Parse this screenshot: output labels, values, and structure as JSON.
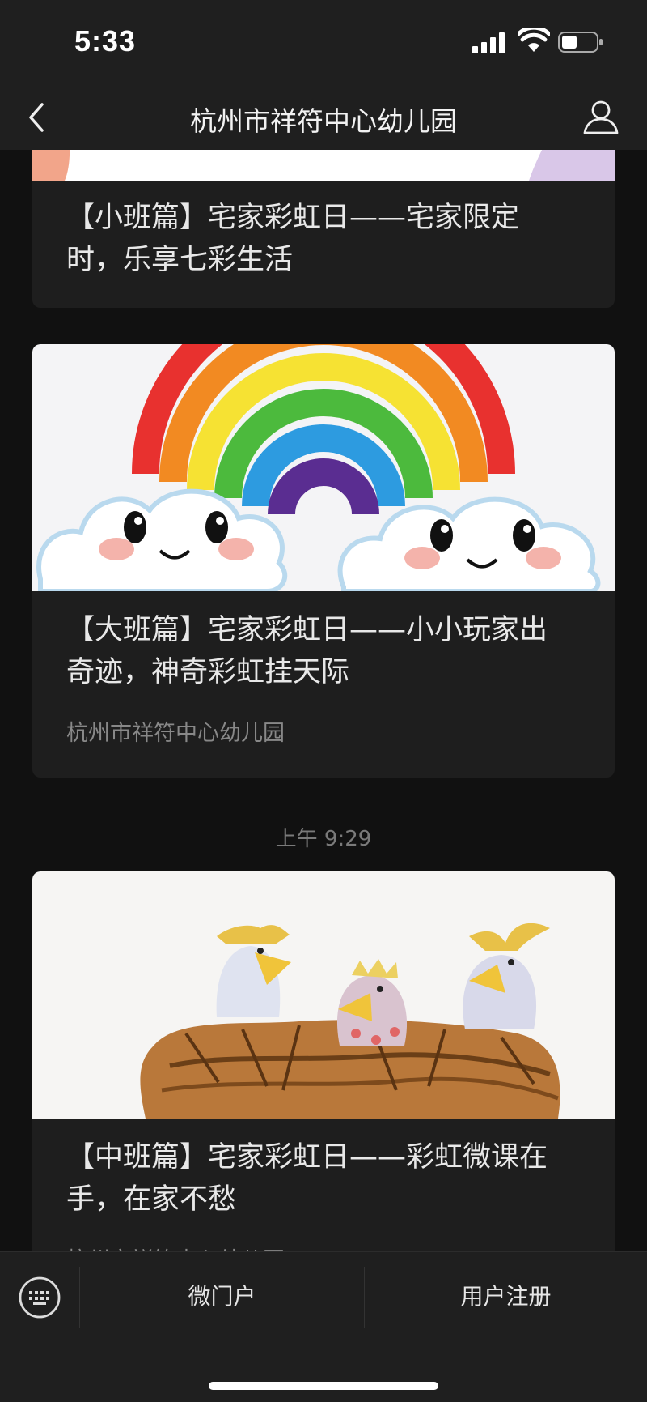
{
  "status_bar": {
    "time": "5:33"
  },
  "nav": {
    "title": "杭州市祥符中心幼儿园"
  },
  "feed": {
    "items": [
      {
        "title_line1": "【小班篇】宅家彩虹日——宅家限定",
        "title_line2": "时，乐享七彩生活",
        "source": ""
      },
      {
        "title_line1": "【大班篇】宅家彩虹日——小小玩家出",
        "title_line2": "奇迹，神奇彩虹挂天际",
        "source": "杭州市祥符中心幼儿园"
      },
      {
        "title_line1": "【中班篇】宅家彩虹日——彩虹微课在",
        "title_line2": "手，在家不愁",
        "source": "杭州市祥符中心幼儿园"
      }
    ],
    "timestamp": "上午 9:29"
  },
  "bottom_menu": {
    "items": [
      {
        "label": "微门户"
      },
      {
        "label": "用户注册"
      }
    ]
  },
  "colors": {
    "background": "#111111",
    "card": "#1e1e1e",
    "bar": "#1f1f1f"
  }
}
